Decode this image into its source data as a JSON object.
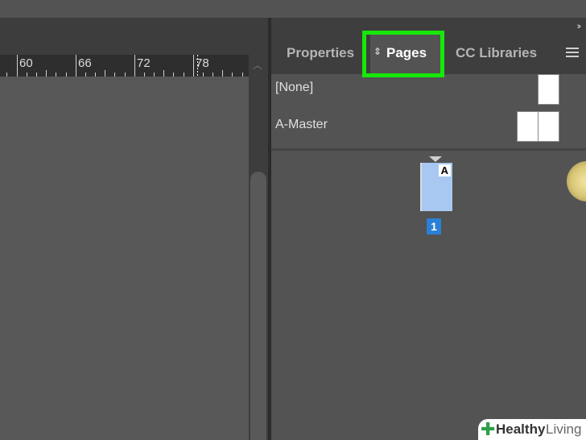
{
  "ruler": {
    "labels": [
      "60",
      "66",
      "72",
      "78"
    ]
  },
  "panel": {
    "tabs": [
      {
        "label": "Properties"
      },
      {
        "label": "Pages"
      },
      {
        "label": "CC Libraries"
      }
    ],
    "collapse_glyph": "››",
    "masters": [
      {
        "label": "[None]"
      },
      {
        "label": "A-Master"
      }
    ],
    "page": {
      "letter": "A",
      "number": "1"
    }
  },
  "watermark": {
    "brand_a": "Healthy",
    "brand_b": "Living"
  },
  "colors": {
    "highlight": "#17e80a",
    "page_number_bg": "#2b80d6",
    "page_thumb": "#a8c8f2"
  }
}
